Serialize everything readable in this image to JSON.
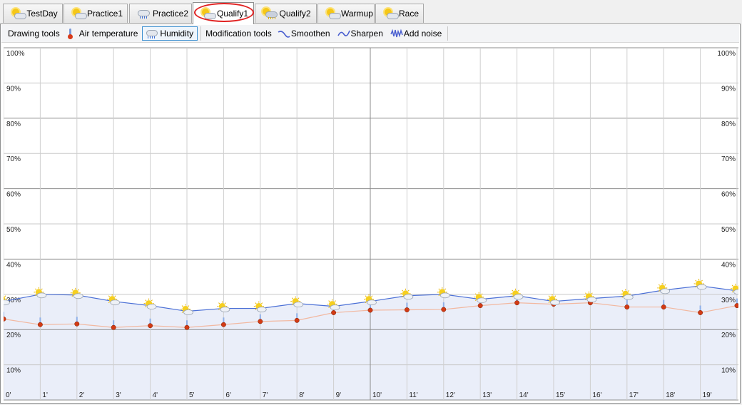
{
  "tabs": [
    {
      "label": "TestDay",
      "icon": "sun-cloud-icon",
      "active": false
    },
    {
      "label": "Practice1",
      "icon": "sun-cloud-icon",
      "active": false
    },
    {
      "label": "Practice2",
      "icon": "rain-cloud-icon",
      "active": false
    },
    {
      "label": "Qualify1",
      "icon": "sun-cloud-icon",
      "active": true
    },
    {
      "label": "Qualify2",
      "icon": "storm-cloud-icon",
      "active": false
    },
    {
      "label": "Warmup",
      "icon": "sun-cloud-icon",
      "active": false
    },
    {
      "label": "Race",
      "icon": "sun-cloud-icon",
      "active": false
    }
  ],
  "toolbar": {
    "drawing_label": "Drawing tools",
    "air_temp_label": "Air temperature",
    "humidity_label": "Humidity",
    "modification_label": "Modification tools",
    "smoothen_label": "Smoothen",
    "sharpen_label": "Sharpen",
    "add_noise_label": "Add noise"
  },
  "colors": {
    "humidity_line": "#4a6fd6",
    "humidity_fill": "#e8ecf8",
    "temperature_line": "#f2b8a0",
    "highlight_ring": "#e02020"
  },
  "chart_data": {
    "type": "line",
    "y_tick_labels": [
      "100%",
      "90%",
      "80%",
      "70%",
      "60%",
      "50%",
      "40%",
      "30%",
      "20%",
      "10%"
    ],
    "x_tick_labels": [
      "0'",
      "1'",
      "2'",
      "3'",
      "4'",
      "5'",
      "6'",
      "7'",
      "8'",
      "9'",
      "10'",
      "11'",
      "12'",
      "13'",
      "14'",
      "15'",
      "16'",
      "17'",
      "18'",
      "19'"
    ],
    "ylim": [
      0,
      100
    ],
    "xlim": [
      0,
      20
    ],
    "series": [
      {
        "name": "Humidity",
        "x": [
          0,
          1,
          2,
          3,
          4,
          5,
          6,
          7,
          8,
          9,
          10,
          11,
          12,
          13,
          14,
          15,
          16,
          17,
          18,
          19,
          20
        ],
        "values": [
          28,
          30,
          29.8,
          28,
          26.8,
          25.2,
          26,
          26,
          27.4,
          26.6,
          28,
          29.6,
          30,
          28.6,
          29.6,
          28,
          28.8,
          29.5,
          31.2,
          32.4,
          31
        ],
        "marker_icon": "sun-cloud-icon"
      },
      {
        "name": "Air temperature",
        "x": [
          0,
          1,
          2,
          3,
          4,
          5,
          6,
          7,
          8,
          9,
          10,
          11,
          12,
          13,
          14,
          15,
          16,
          17,
          18,
          19,
          20
        ],
        "values": [
          23,
          21.4,
          21.6,
          20.6,
          21.1,
          20.6,
          21.4,
          22.3,
          22.6,
          24.8,
          25.5,
          25.6,
          25.7,
          26.8,
          27.6,
          27.2,
          27.6,
          26.4,
          26.4,
          24.8,
          26.8
        ],
        "marker_icon": "thermometer-icon"
      }
    ]
  }
}
